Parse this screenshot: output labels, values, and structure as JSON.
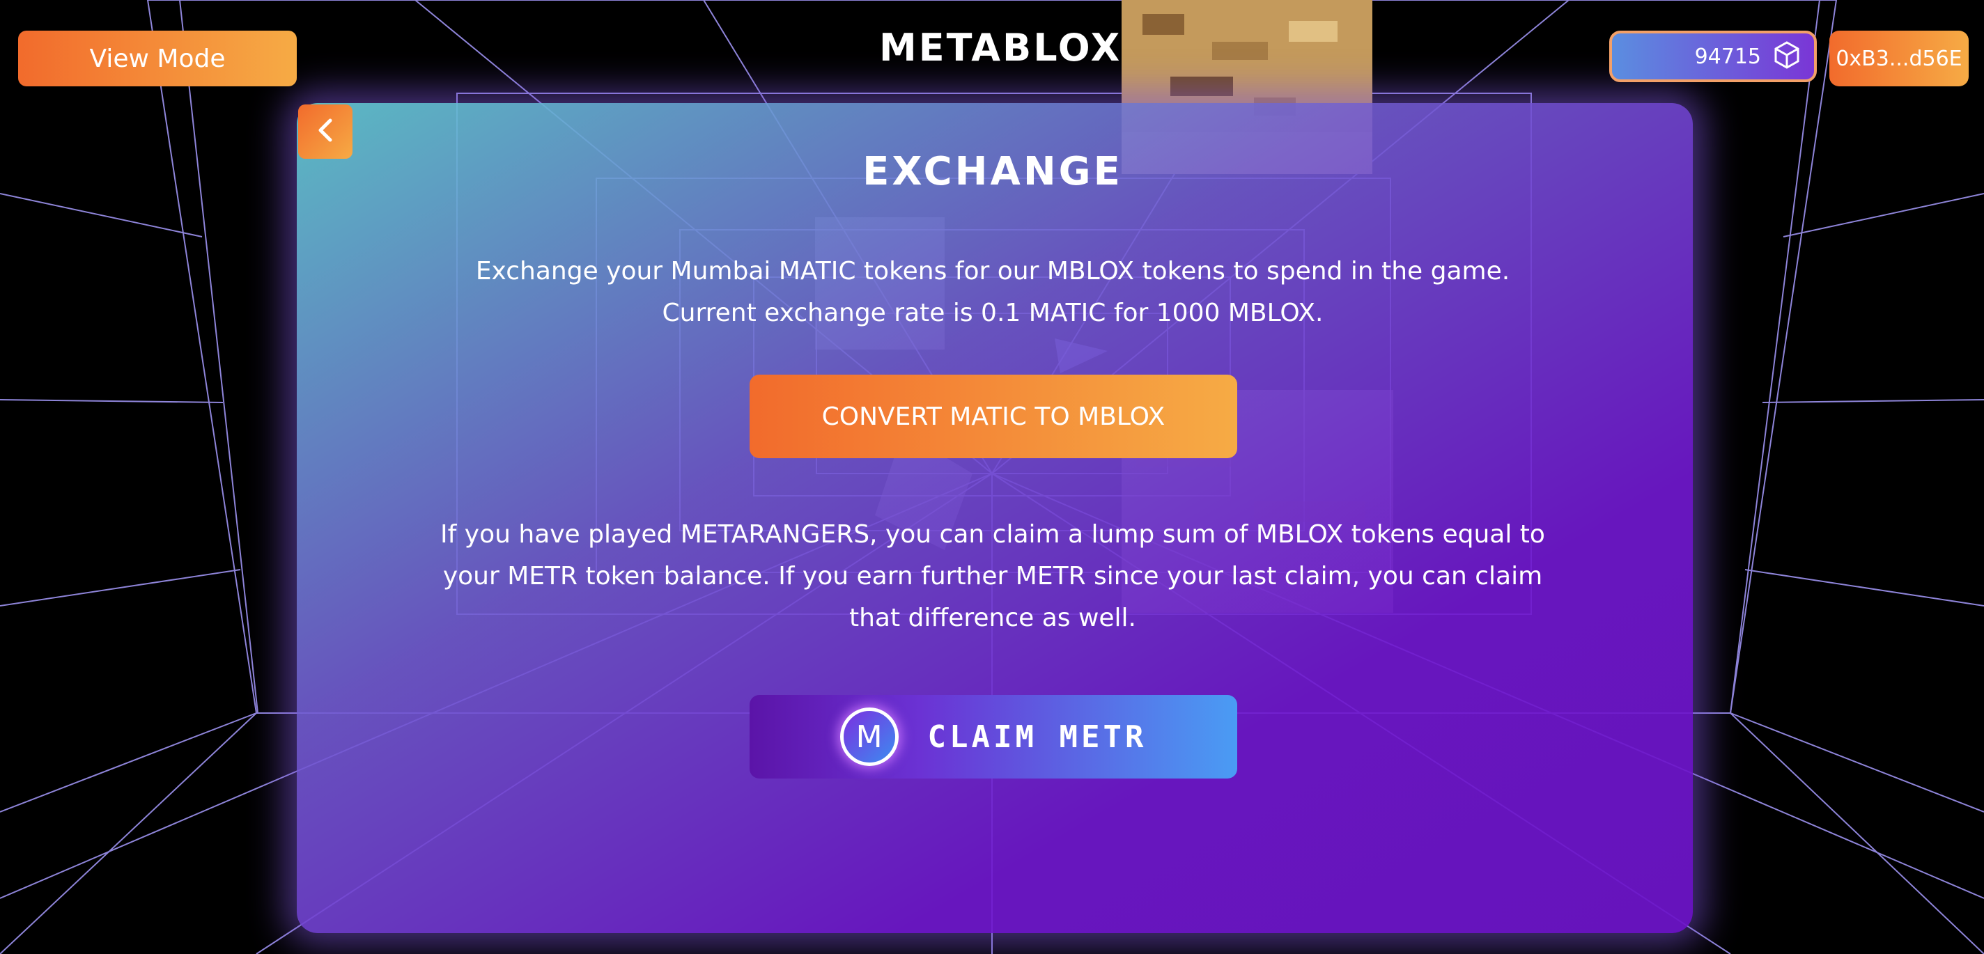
{
  "header": {
    "view_mode_label": "View Mode",
    "logo": "METABLOX",
    "token_balance": "94715",
    "token_icon": "cube-icon",
    "wallet_address": "0xB3...d56E"
  },
  "exchange": {
    "back_icon": "chevron-left-icon",
    "title": "EXCHANGE",
    "intro_line1": "Exchange your Mumbai MATIC tokens for our MBLOX tokens to spend in the game.",
    "intro_line2": "Current exchange rate is 0.1 MATIC for 1000 MBLOX.",
    "convert_label": "CONVERT MATIC TO MBLOX",
    "claim_info_line1": "If you have played METARANGERS, you can claim a lump sum of MBLOX tokens equal to",
    "claim_info_line2": "your METR token balance. If you earn further METR since your last claim, you can claim",
    "claim_info_line3": "that difference as well.",
    "claim_icon_letter": "M",
    "claim_label": "CLAIM METR"
  },
  "colors": {
    "accent_orange_start": "#f26b2c",
    "accent_orange_end": "#f6ab45",
    "panel_purple": "#6c14c8",
    "grid_line": "#a79cff"
  }
}
